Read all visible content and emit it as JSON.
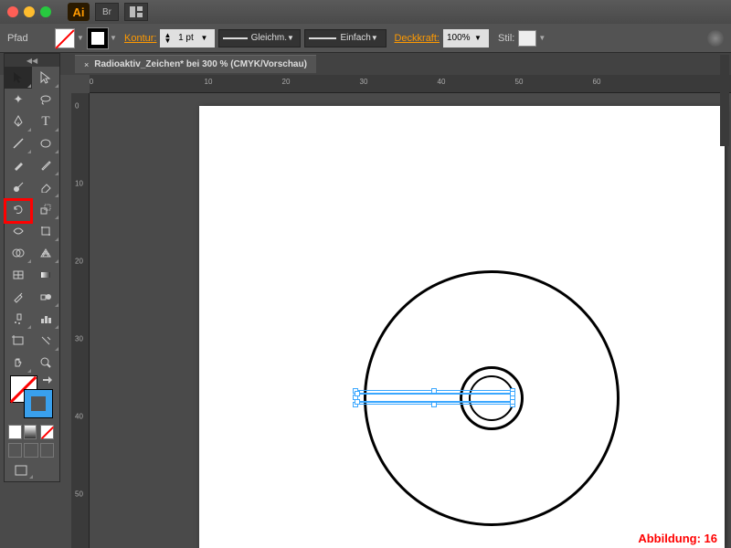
{
  "titlebar": {
    "app": "Ai",
    "bridge": "Br"
  },
  "control": {
    "path_label": "Pfad",
    "stroke_label": "Kontur:",
    "stroke_weight": "1 pt",
    "profile": "Gleichm.",
    "brush": "Einfach",
    "opacity_label": "Deckkraft:",
    "opacity": "100%",
    "style_label": "Stil:"
  },
  "doc_tab": "Radioaktiv_Zeichen* bei 300 % (CMYK/Vorschau)",
  "ruler_h": [
    "0",
    "10",
    "20",
    "30",
    "40",
    "50",
    "60"
  ],
  "ruler_v": [
    "0",
    "10",
    "20",
    "30",
    "40",
    "50"
  ],
  "figure_label": "Abbildung: 16",
  "tools_left": [
    "sel-arrow",
    "direct-sel",
    "wand",
    "lasso",
    "pen",
    "type",
    "line",
    "ellipse",
    "brush",
    "pencil",
    "blob",
    "eraser",
    "rotate",
    "scale",
    "width",
    "free",
    "shapebuilder",
    "perspective",
    "mesh",
    "gradient",
    "eyedropper",
    "blend",
    "symbol",
    "graph",
    "artboard",
    "slice",
    "hand",
    "zoom"
  ]
}
